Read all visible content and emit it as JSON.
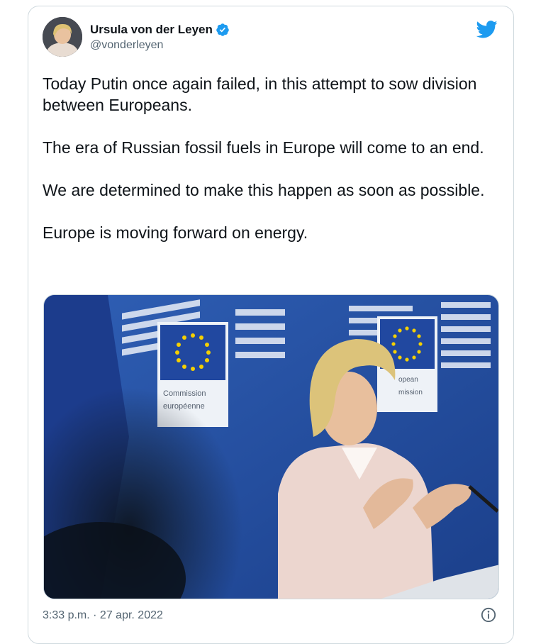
{
  "tweet": {
    "author": {
      "display_name": "Ursula von der Leyen",
      "handle": "@vonderleyen",
      "verified": true
    },
    "paragraphs": [
      "Today Putin once again failed, in this attempt to sow division between Europeans.",
      "The era of Russian fossil fuels in Europe will come to an end.",
      "We are determined to make this happen as soon as possible.",
      "Europe is moving forward on energy."
    ],
    "photo": {
      "sign_left_line1": "Commission",
      "sign_left_line2": "européenne",
      "sign_right_line1": "opean",
      "sign_right_line2": "mission"
    },
    "timestamp": "3:33 p.m. · 27 apr. 2022"
  },
  "colors": {
    "twitter_blue": "#1d9bf0",
    "text_primary": "#0f1419",
    "text_secondary": "#536471",
    "eu_blue": "#1f4fa8",
    "eu_star": "#f5d000"
  },
  "icons": {
    "verified": "verified-badge-icon",
    "brand": "twitter-bird-icon",
    "info": "info-circle-icon"
  }
}
